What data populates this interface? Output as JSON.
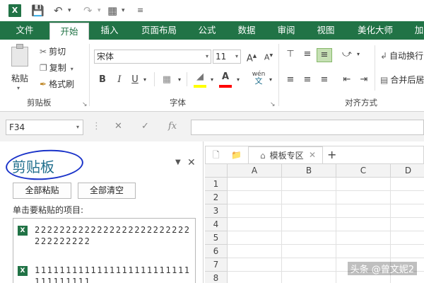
{
  "quick_access": {
    "app_icon": "excel-icon",
    "icons": [
      "save-icon",
      "undo-icon",
      "redo-icon",
      "customize-icon"
    ]
  },
  "tabs": [
    "文件",
    "开始",
    "插入",
    "页面布局",
    "公式",
    "数据",
    "审阅",
    "视图",
    "美化大师",
    "加"
  ],
  "ribbon": {
    "clipboard": {
      "paste_label": "粘贴",
      "cut_label": "剪切",
      "copy_label": "复制",
      "format_painter_label": "格式刷",
      "group_name": "剪贴板"
    },
    "font": {
      "font_name": "宋体",
      "font_size": "11",
      "bold": "B",
      "italic": "I",
      "underline": "U",
      "wen": "wén",
      "group_name": "字体"
    },
    "alignment": {
      "wrap_label": "自动换行",
      "merge_label": "合并后居中",
      "group_name": "对齐方式"
    }
  },
  "formula_bar": {
    "name_box": "F34",
    "formula": ""
  },
  "clipboard_pane": {
    "title": "剪贴板",
    "paste_all": "全部粘贴",
    "clear_all": "全部清空",
    "instruction": "单击要粘贴的项目:",
    "items": [
      {
        "text": "2222222222222222222222222222222222"
      },
      {
        "text": "1111111111111111111111111111111111"
      }
    ]
  },
  "workbook": {
    "template_tab": "模板专区",
    "columns": [
      "A",
      "B",
      "C",
      "D"
    ],
    "rows": [
      "1",
      "2",
      "3",
      "4",
      "5",
      "6",
      "7",
      "8"
    ]
  },
  "watermark": "头条 @曾文妮2",
  "colors": {
    "excel_green": "#217346",
    "annotation_blue": "#1a33c9",
    "highlight_yellow": "#ffff00",
    "font_red": "#ff0000"
  }
}
